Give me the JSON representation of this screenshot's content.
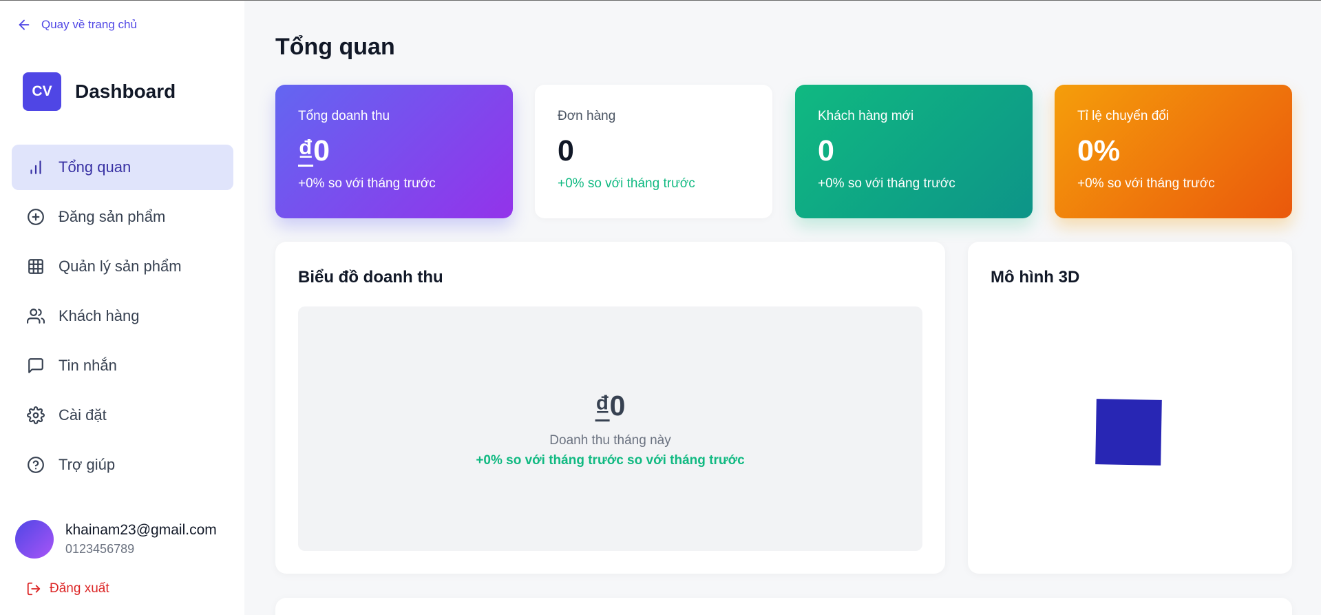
{
  "back_link": {
    "label": "Quay về trang chủ"
  },
  "brand": {
    "logo": "CV",
    "name": "Dashboard"
  },
  "nav": [
    {
      "label": "Tổng quan",
      "icon": "bar-chart-icon",
      "active": true
    },
    {
      "label": "Đăng sản phẩm",
      "icon": "plus-circle-icon"
    },
    {
      "label": "Quản lý sản phẩm",
      "icon": "grid-icon"
    },
    {
      "label": "Khách hàng",
      "icon": "users-icon"
    },
    {
      "label": "Tin nhắn",
      "icon": "message-icon"
    },
    {
      "label": "Cài đặt",
      "icon": "gear-icon"
    },
    {
      "label": "Trợ giúp",
      "icon": "help-circle-icon"
    }
  ],
  "user": {
    "email": "khainam23@gmail.com",
    "phone": "0123456789"
  },
  "logout": {
    "label": "Đăng xuất"
  },
  "page_title": "Tổng quan",
  "stats": [
    {
      "label": "Tổng doanh thu",
      "currency": "₫",
      "value": "0",
      "delta": "+0% so với tháng trước"
    },
    {
      "label": "Đơn hàng",
      "value": "0",
      "delta": "+0% so với tháng trước"
    },
    {
      "label": "Khách hàng mới",
      "value": "0",
      "delta": "+0% so với tháng trước"
    },
    {
      "label": "Tỉ lệ chuyển đổi",
      "value": "0%",
      "delta": "+0% so với tháng trước"
    }
  ],
  "revenue_chart": {
    "title": "Biểu đồ doanh thu",
    "currency": "₫",
    "value": "0",
    "subtitle": "Doanh thu tháng này",
    "delta": "+0% so với tháng trước so với tháng trước"
  },
  "model_3d": {
    "title": "Mô hình 3D",
    "cube_color": "#2826b4"
  },
  "colors": {
    "accent": "#4f46e5",
    "success": "#10b981",
    "danger": "#dc2626",
    "orange": "#f59e0b"
  }
}
